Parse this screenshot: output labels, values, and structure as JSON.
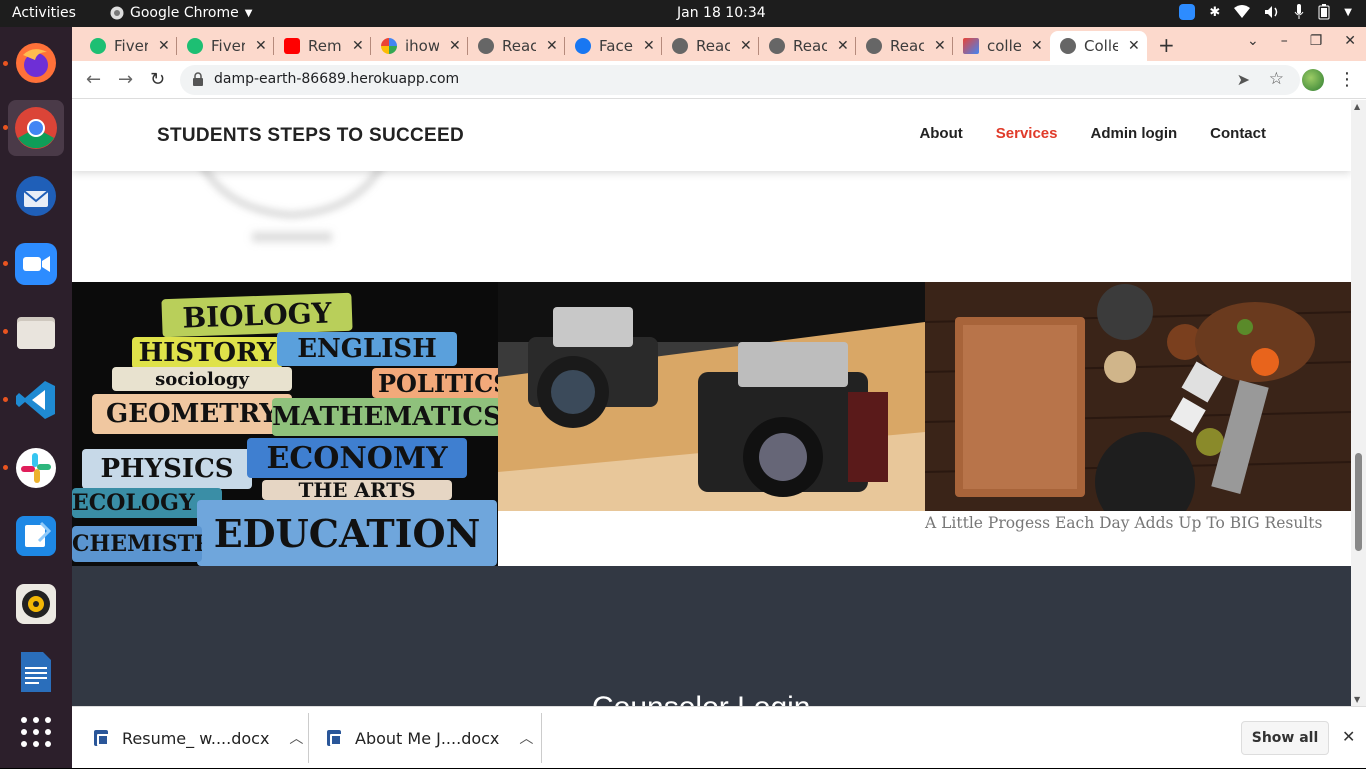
{
  "topbar": {
    "activities": "Activities",
    "app_name": "Google Chrome",
    "clock": "Jan 18  10:34",
    "tray_icons": [
      "zoom-icon",
      "slack-icon",
      "wifi-icon",
      "volume-icon",
      "mic-icon",
      "battery-icon",
      "power-menu-icon"
    ]
  },
  "dock": {
    "items": [
      "firefox-icon",
      "chrome-icon",
      "thunderbird-icon",
      "zoom-icon",
      "files-icon",
      "vscode-icon",
      "slack-icon",
      "whiteboard-icon",
      "rhythmbox-icon",
      "libreoffice-writer-icon",
      "app-grid-icon"
    ]
  },
  "tabs": [
    {
      "title": "Fiverr",
      "icon": "fiverr-icon"
    },
    {
      "title": "Fiverr",
      "icon": "fiverr-icon"
    },
    {
      "title": "Remove",
      "icon": "youtube-icon"
    },
    {
      "title": "ihow",
      "icon": "google-icon"
    },
    {
      "title": "React",
      "icon": "globe-icon"
    },
    {
      "title": "Facebook",
      "icon": "facebook-icon"
    },
    {
      "title": "React",
      "icon": "globe-icon"
    },
    {
      "title": "React",
      "icon": "globe-icon"
    },
    {
      "title": "React",
      "icon": "globe-icon"
    },
    {
      "title": "college",
      "icon": "gmail-icon"
    },
    {
      "title": "College",
      "icon": "globe-icon"
    }
  ],
  "toolbar": {
    "url": "damp-earth-86689.herokuapp.com"
  },
  "site": {
    "brand": "STUDENTS STEPS TO SUCCEED",
    "nav": [
      "About",
      "Services",
      "Admin login",
      "Contact"
    ],
    "active_nav": "Services",
    "accent": "#e03b2a",
    "books": [
      "BIOLOGY",
      "HISTORY",
      "ENGLISH",
      "sociology",
      "POLITICS",
      "GEOMETRY",
      "MATHEMATICS",
      "PHYSICS",
      "ECONOMY",
      "THE ARTS",
      "ECOLOGY",
      "EDUCATION",
      "CHEMISTRY"
    ],
    "caption": "A Little Progess Each Day Adds Up To BIG Results",
    "section_title": "Counselor Login"
  },
  "downloads": {
    "items": [
      "Resume_ w....docx",
      "About Me J....docx"
    ],
    "show_all": "Show all"
  }
}
